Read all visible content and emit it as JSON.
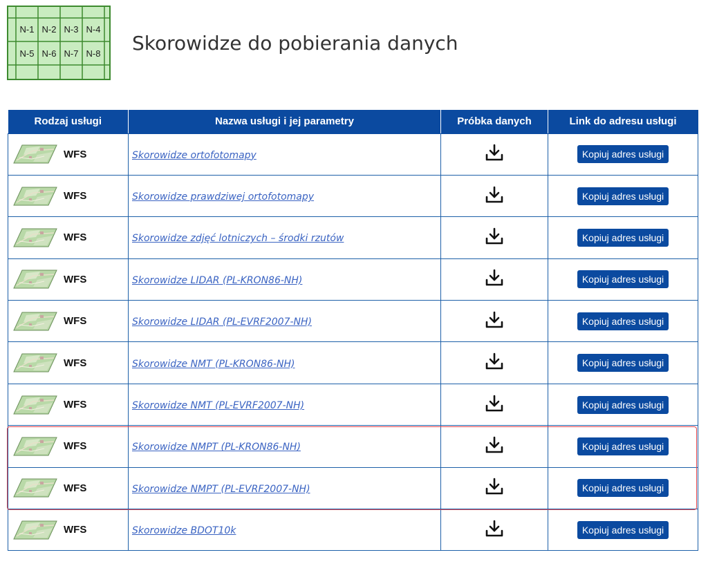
{
  "logo": {
    "cells": [
      "N-1",
      "N-2",
      "N-3",
      "N-4",
      "N-5",
      "N-6",
      "N-7",
      "N-8"
    ]
  },
  "page_title": "Skorowidze do pobierania danych",
  "table": {
    "headers": [
      "Rodzaj usługi",
      "Nazwa usługi i jej parametry",
      "Próbka danych",
      "Link do adresu usługi"
    ],
    "rows": [
      {
        "type": "WFS",
        "name": "Skorowidze ortofotomapy",
        "button": "Kopiuj adres usługi"
      },
      {
        "type": "WFS",
        "name": "Skorowidze prawdziwej ortofotomapy",
        "button": "Kopiuj adres usługi"
      },
      {
        "type": "WFS",
        "name": "Skorowidze zdjęć lotniczych – środki rzutów",
        "button": "Kopiuj adres usługi"
      },
      {
        "type": "WFS",
        "name": "Skorowidze LIDAR (PL-KRON86-NH)",
        "button": "Kopiuj adres usługi"
      },
      {
        "type": "WFS",
        "name": "Skorowidze LIDAR (PL-EVRF2007-NH)",
        "button": "Kopiuj adres usługi"
      },
      {
        "type": "WFS",
        "name": "Skorowidze NMT (PL-KRON86-NH) ",
        "button": "Kopiuj adres usługi"
      },
      {
        "type": "WFS",
        "name": "Skorowidze NMT (PL-EVRF2007-NH) ",
        "button": "Kopiuj adres usługi"
      },
      {
        "type": "WFS",
        "name": "Skorowidze NMPT (PL-KRON86-NH) ",
        "button": "Kopiuj adres usługi"
      },
      {
        "type": "WFS",
        "name": "Skorowidze NMPT (PL-EVRF2007-NH) ",
        "button": "Kopiuj adres usługi"
      },
      {
        "type": "WFS",
        "name": "Skorowidze BDOT10k ",
        "button": "Kopiuj adres usługi"
      }
    ]
  },
  "icons": {
    "download": "download-icon",
    "thumbnail": "map-thumbnail-icon"
  },
  "colors": {
    "header_bg": "#0b4aa0",
    "button_bg": "#0b4aa0",
    "link": "#3a63c2",
    "highlight": "#e0424a"
  }
}
